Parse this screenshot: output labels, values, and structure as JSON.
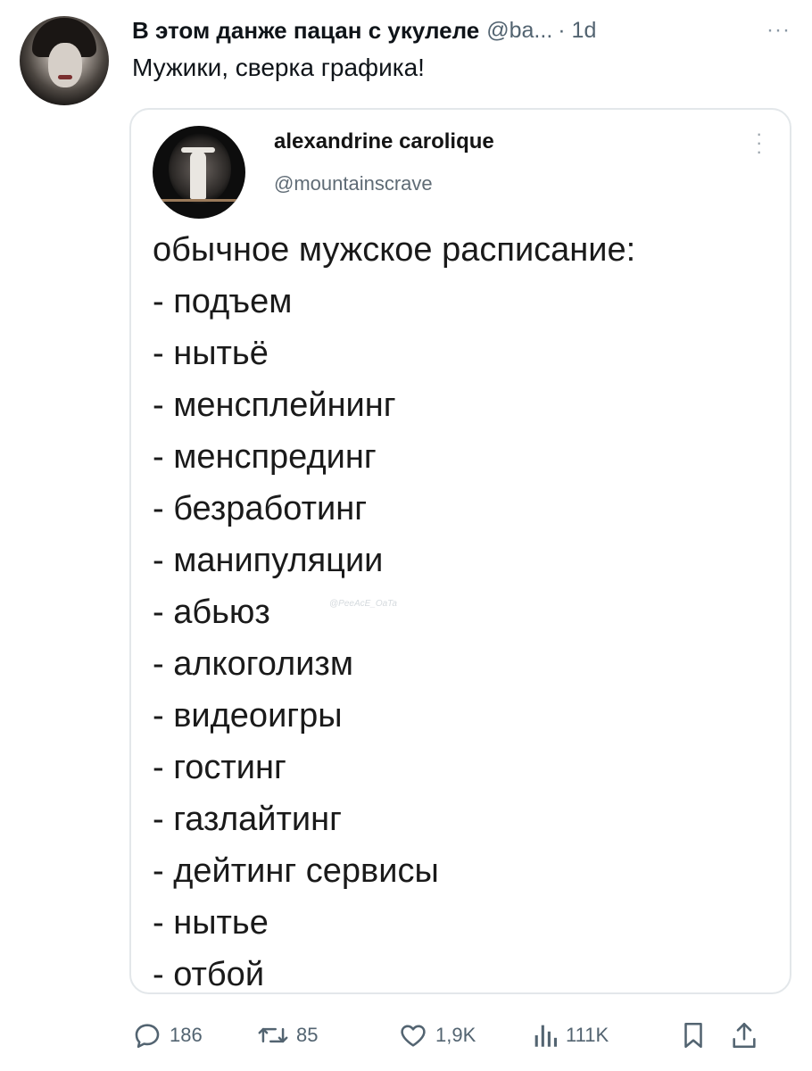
{
  "post": {
    "author_name": "В этом данже пацан с укулеле",
    "author_handle": "@ba...",
    "timestamp": "· 1d",
    "more_label": "···",
    "text": "Мужики, сверка графика!"
  },
  "quoted": {
    "author_name": "alexandrine carolique",
    "author_handle": "@mountainscrave",
    "lines": [
      "обычное мужское расписание:",
      "- подъем",
      "- нытьё",
      "- менсплейнинг",
      "- менспрединг",
      "- безработинг",
      "- манипуляции",
      "- абьюз",
      "- алкоголизм",
      "- видеоигры",
      "- гостинг",
      "- газлайтинг",
      "- дейтинг сервисы",
      "- нытье",
      "- отбой"
    ],
    "watermark": "@PeeAcE_OaTa"
  },
  "actions": {
    "replies": "186",
    "reposts": "85",
    "likes": "1,9K",
    "views": "111K"
  },
  "icons": [
    "reply-icon",
    "repost-icon",
    "like-icon",
    "views-icon",
    "bookmark-icon",
    "share-icon",
    "more-icon"
  ]
}
